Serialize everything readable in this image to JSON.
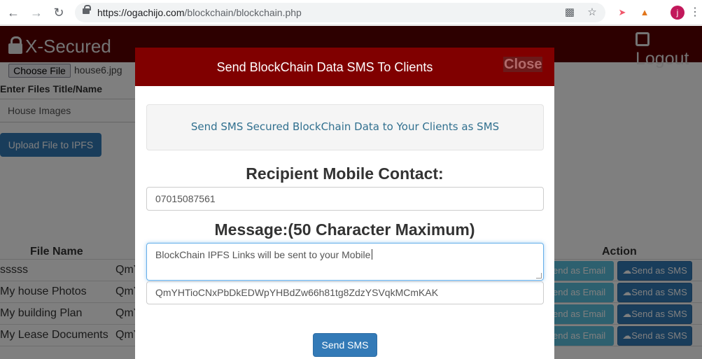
{
  "browser": {
    "url_host": "https://ogachijo.com",
    "url_path": "/blockchain/blockchain.php",
    "profile_initial": "j",
    "icons": {
      "back": "arrow-left-icon",
      "forward": "arrow-right-icon",
      "reload": "reload-icon",
      "lock": "lock-icon",
      "camera": "camera-blocked-icon",
      "star": "star-icon"
    }
  },
  "header": {
    "brand": "X-Secured",
    "logout": "Logout"
  },
  "upload_form": {
    "choose_file_label": "Choose File",
    "selected_file": "house6.jpg",
    "title_label": "Enter Files Title/Name",
    "title_value": "House Images",
    "upload_button": "Upload File to IPFS"
  },
  "files_table": {
    "headers": {
      "file_name": "File Name",
      "action": "Action"
    },
    "rows": [
      {
        "name": "sssss",
        "hash": "QmY"
      },
      {
        "name": "My house Photos",
        "hash": "QmY"
      },
      {
        "name": "My building Plan",
        "hash": "QmY"
      },
      {
        "name": "My Lease Documents",
        "hash": "QmY"
      }
    ],
    "email_button": "end as Email",
    "sms_button": "Send as SMS"
  },
  "modal": {
    "title": "Send BlockChain Data SMS To Clients",
    "close_label": "Close",
    "info_text": "Send SMS Secured BlockChain Data to Your Clients as SMS",
    "recipient_label": "Recipient Mobile Contact:",
    "phone_value": "07015087561",
    "message_label": "Message:(50 Character Maximum)",
    "message_value": "BlockChain IPFS Links will be sent to your Mobile",
    "hash_value": "QmYHTioCNxPbDkEDWpYHBdZw66h81tg8ZdzYSVqkMCmKAK",
    "send_button": "Send SMS"
  },
  "colors": {
    "header_bg": "#5a0000",
    "modal_header_bg": "#800000",
    "primary": "#337ab7",
    "info": "#5bc0de"
  }
}
